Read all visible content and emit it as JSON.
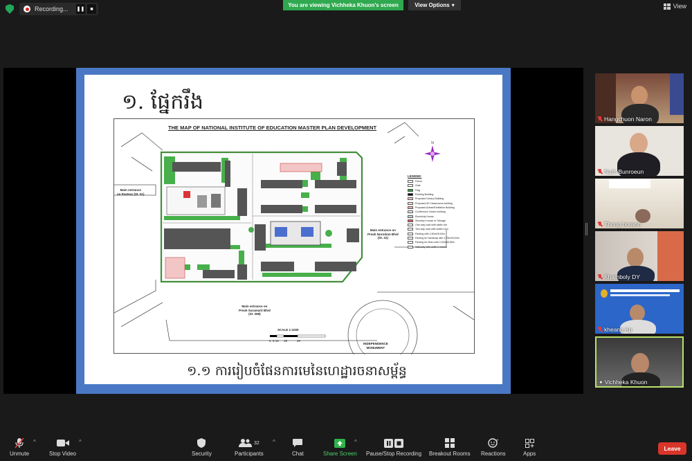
{
  "top_bar": {
    "recording_label": "Recording...",
    "pause_icon": "pause-icon",
    "stop_icon": "stop-icon",
    "viewing_banner": "You are viewing Vichheka Khuon's screen",
    "view_options_label": "View Options",
    "view_label": "View"
  },
  "slide": {
    "title": "១. ផ្នែករឹង",
    "subtitle": "១.១ ការរៀបចំផែនការមេនៃហេដ្ឋារចនាសម្ព័ន្ធ",
    "map_heading": "THE MAP OF NATIONAL INSTITUTE OF EDUCATION MASTER PLAN DEVELOPMENT",
    "label_pasteur": "Main entrance\non Pasteur (St. 51)",
    "label_norodom": "Main entrance on\nPreah Norodom Blvd\n(St. 41)",
    "label_sihanouk": "Main entrance on\nPreah Suramarit Blvd\n(St. 268)",
    "label_monument": "INDEPENDENCE\nMONUMENT",
    "scale_label": "SCALE 1:1000",
    "scale_ticks": "0  5 10      20           40",
    "legend_title": "LEGEND:",
    "legend": [
      {
        "label": "Fence",
        "color": "#ffffff"
      },
      {
        "label": "Gate",
        "color": "#ffffff"
      },
      {
        "label": "Flag",
        "color": "#2c9c3c"
      },
      {
        "label": "Existing Building",
        "color": "#111111"
      },
      {
        "label": "Proposed Library Building",
        "color": "#f3c6c6"
      },
      {
        "label": "Proposed 50 Classrooms building",
        "color": "#f8dede"
      },
      {
        "label": "Proposed Admin/Exhibition Building",
        "color": "#f0b0b0"
      },
      {
        "label": "Conference Center building",
        "color": "#e8e8e8"
      },
      {
        "label": "Electricity House",
        "color": "#d0d0d0"
      },
      {
        "label": "Security's house or Storage",
        "color": "#e06060"
      },
      {
        "label": "One way road with width=4m",
        "color": "#ffffff"
      },
      {
        "label": "Two way road with width=11m",
        "color": "#ffffff"
      },
      {
        "label": "Parking with 2,50mX5,00m",
        "color": "#ffffff"
      },
      {
        "label": "Parking for handicap with 3,75mX5,00m",
        "color": "#ffffff"
      },
      {
        "label": "Parking for Moto with 2,00mX0,80m",
        "color": "#ffffff"
      },
      {
        "label": "Walkway with width 2 meters",
        "color": "#ffffff"
      }
    ]
  },
  "participants": [
    {
      "name": "Hangchuon Naron"
    },
    {
      "name": "Nath Bunroeun"
    },
    {
      "name": "Thong borann"
    },
    {
      "name": "Khamboly DY"
    },
    {
      "name": "kheang Ap"
    },
    {
      "name": "Vichheka Khuon"
    }
  ],
  "toolbar": {
    "unmute": "Unmute",
    "stop_video": "Stop Video",
    "security": "Security",
    "participants": "Participants",
    "participant_count": "32",
    "chat": "Chat",
    "share_screen": "Share Screen",
    "pause_stop_recording": "Pause/Stop Recording",
    "breakout_rooms": "Breakout Rooms",
    "reactions": "Reactions",
    "apps": "Apps",
    "leave": "Leave"
  }
}
